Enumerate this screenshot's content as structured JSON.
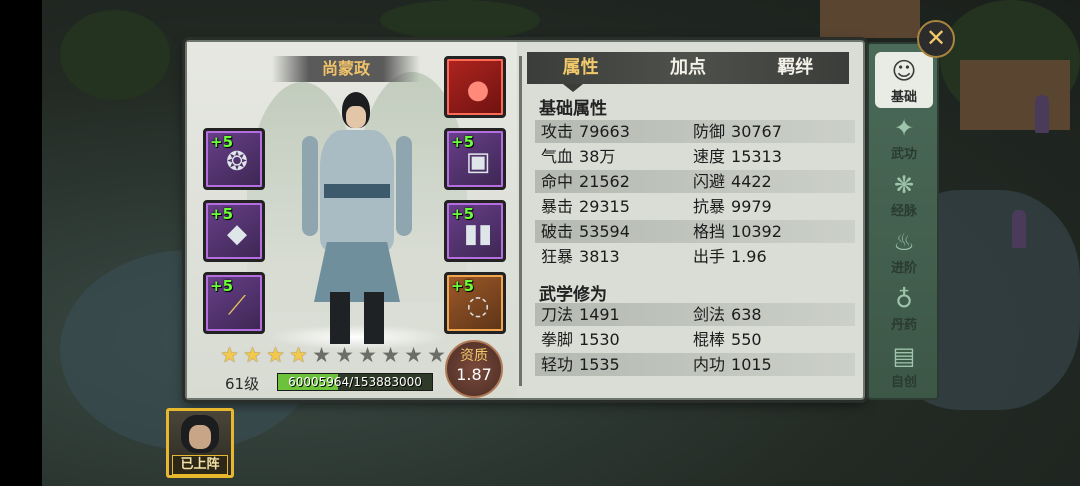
{
  "character": {
    "name": "尚蒙政",
    "level": "61级",
    "exp_text": "60005964/153883000",
    "exp_current": 60005964,
    "exp_max": 153883000,
    "stars_total": 10,
    "stars_filled": 4,
    "aptitude_label": "资质",
    "aptitude_value": "1.87"
  },
  "equipment_left": [
    {
      "bonus": "+5",
      "icon": "dragon-ornament-icon",
      "rarity": "purple"
    },
    {
      "bonus": "+5",
      "icon": "belt-icon",
      "rarity": "purple"
    },
    {
      "bonus": "+5",
      "icon": "staff-icon",
      "rarity": "purple"
    }
  ],
  "equipment_right": [
    {
      "bonus": "",
      "icon": "red-toad-icon",
      "rarity": "red"
    },
    {
      "bonus": "+5",
      "icon": "armor-icon",
      "rarity": "purple"
    },
    {
      "bonus": "+5",
      "icon": "boots-icon",
      "rarity": "purple"
    },
    {
      "bonus": "+5",
      "icon": "necklace-icon",
      "rarity": "orange"
    }
  ],
  "tabs": [
    {
      "label": "属性",
      "active": true
    },
    {
      "label": "加点",
      "active": false
    },
    {
      "label": "羁绊",
      "active": false
    }
  ],
  "base_title": "基础属性",
  "base_stats": [
    [
      {
        "k": "攻击",
        "v": "79663"
      },
      {
        "k": "防御",
        "v": "30767"
      }
    ],
    [
      {
        "k": "气血",
        "v": "38万"
      },
      {
        "k": "速度",
        "v": "15313"
      }
    ],
    [
      {
        "k": "命中",
        "v": "21562"
      },
      {
        "k": "闪避",
        "v": "4422"
      }
    ],
    [
      {
        "k": "暴击",
        "v": "29315"
      },
      {
        "k": "抗暴",
        "v": "9979"
      }
    ],
    [
      {
        "k": "破击",
        "v": "53594"
      },
      {
        "k": "格挡",
        "v": "10392"
      }
    ],
    [
      {
        "k": "狂暴",
        "v": "3813"
      },
      {
        "k": "出手",
        "v": "1.96"
      }
    ]
  ],
  "martial_title": "武学修为",
  "martial_stats": [
    [
      {
        "k": "刀法",
        "v": "1491"
      },
      {
        "k": "剑法",
        "v": "638"
      }
    ],
    [
      {
        "k": "拳脚",
        "v": "1530"
      },
      {
        "k": "棍棒",
        "v": "550"
      }
    ],
    [
      {
        "k": "轻功",
        "v": "1535"
      },
      {
        "k": "内功",
        "v": "1015"
      }
    ]
  ],
  "sidenav": [
    {
      "label": "基础",
      "icon": "scholar-icon",
      "active": true
    },
    {
      "label": "武功",
      "icon": "kick-icon",
      "active": false
    },
    {
      "label": "经脉",
      "icon": "meridian-icon",
      "active": false
    },
    {
      "label": "进阶",
      "icon": "flame-icon",
      "active": false
    },
    {
      "label": "丹药",
      "icon": "gourd-icon",
      "active": false
    },
    {
      "label": "自创",
      "icon": "book-icon",
      "active": false
    }
  ],
  "close_icon": "close-icon",
  "team_card": {
    "badge": "已上阵"
  },
  "colors": {
    "accent_gold": "#f1c86a",
    "exp_green": "#6cc23a",
    "plus_green": "#6cff3a"
  }
}
